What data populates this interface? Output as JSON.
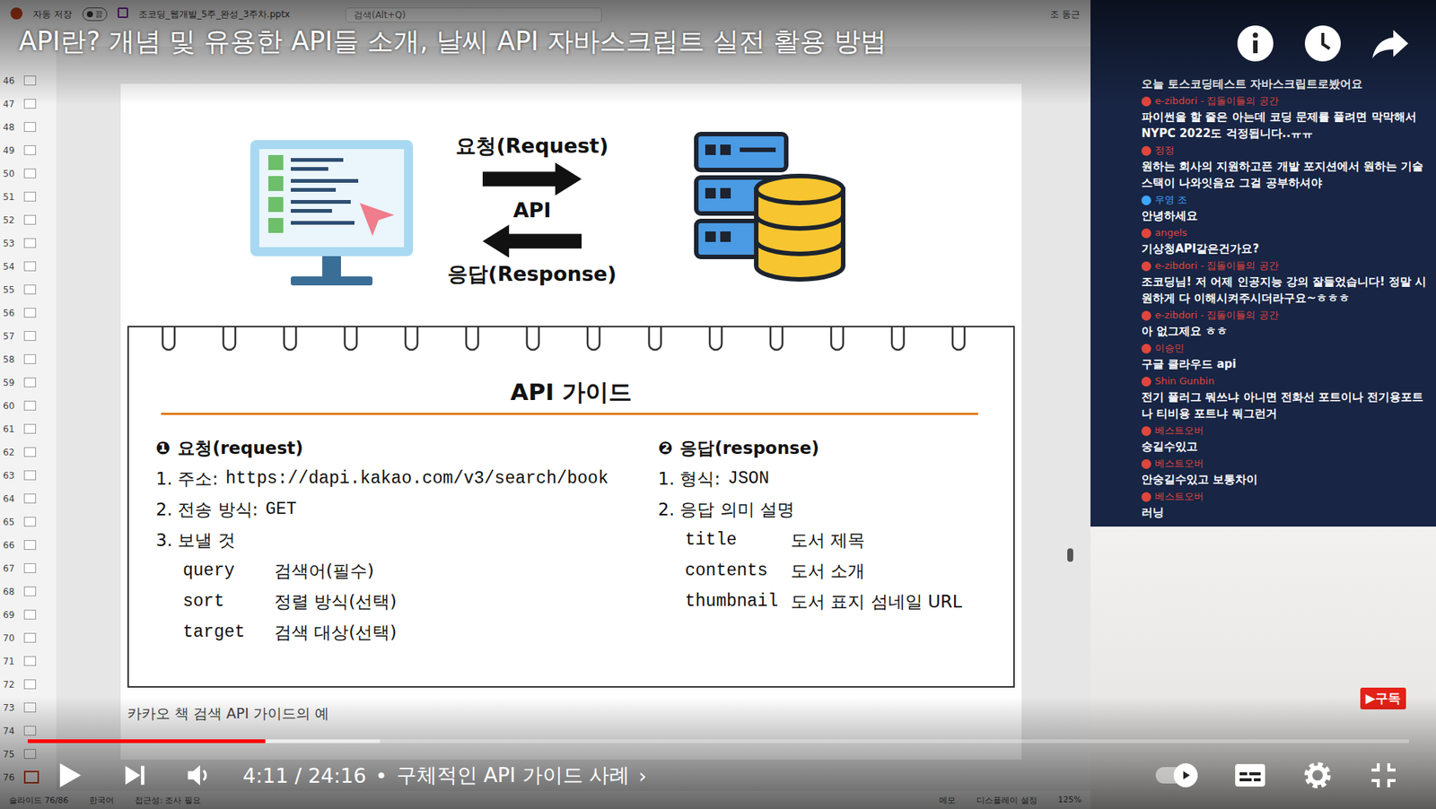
{
  "video": {
    "title": "API란? 개념 및 유용한 API들 소개, 날씨 API 자바스크립트 실전 활용 방법",
    "current_time": "4:11",
    "duration": "24:16",
    "separator": "•",
    "chapter": "구체적인 API 가이드 사례",
    "chapter_arrow": "›",
    "played": 0.172,
    "buffered": 0.255,
    "playing": false,
    "autoplay": true,
    "subtitles": false,
    "subscribe_badge": "▶구독"
  },
  "ppt": {
    "autosave_label": "자동 저장",
    "autosave_state": "끔",
    "autosave_on": false,
    "file_name": "조코딩_웹개발_5주_완성_3주차.pptx",
    "search_placeholder": "검색(Alt+Q)",
    "user": "조 동근",
    "thumbnails": [
      {
        "n": "46",
        "selected": false
      },
      {
        "n": "47",
        "selected": false
      },
      {
        "n": "48",
        "selected": false
      },
      {
        "n": "49",
        "selected": false
      },
      {
        "n": "50",
        "selected": false
      },
      {
        "n": "51",
        "selected": false
      },
      {
        "n": "52",
        "selected": false
      },
      {
        "n": "53",
        "selected": false
      },
      {
        "n": "54",
        "selected": false
      },
      {
        "n": "55",
        "selected": false
      },
      {
        "n": "56",
        "selected": false
      },
      {
        "n": "57",
        "selected": false
      },
      {
        "n": "58",
        "selected": false
      },
      {
        "n": "59",
        "selected": false
      },
      {
        "n": "60",
        "selected": false
      },
      {
        "n": "61",
        "selected": false
      },
      {
        "n": "62",
        "selected": false
      },
      {
        "n": "63",
        "selected": false
      },
      {
        "n": "64",
        "selected": false
      },
      {
        "n": "65",
        "selected": false
      },
      {
        "n": "66",
        "selected": false
      },
      {
        "n": "67",
        "selected": false
      },
      {
        "n": "68",
        "selected": false
      },
      {
        "n": "69",
        "selected": false
      },
      {
        "n": "70",
        "selected": false
      },
      {
        "n": "71",
        "selected": false
      },
      {
        "n": "72",
        "selected": false
      },
      {
        "n": "73",
        "selected": false
      },
      {
        "n": "74",
        "selected": false
      },
      {
        "n": "75",
        "selected": false
      },
      {
        "n": "76",
        "selected": true
      }
    ],
    "status_bar": {
      "left": [
        "슬라이드 76/86",
        "한국어",
        "접근성: 조사 필요"
      ],
      "right": [
        "메모",
        "디스플레이 설정",
        "125%"
      ]
    }
  },
  "slide": {
    "diagram": {
      "request": "요청(Request)",
      "api": "API",
      "response": "응답(Response)"
    },
    "guide_title": "API 가이드",
    "request": {
      "badge": "❶",
      "heading": "요청(request)",
      "items": [
        {
          "label": "1. 주소:",
          "value": "https://dapi.kakao.com/v3/search/book"
        },
        {
          "label": "2. 전송 방식:",
          "value": "GET"
        },
        {
          "label": "3. 보낼 것"
        }
      ],
      "params": [
        {
          "key": "query",
          "desc": "검색어(필수)"
        },
        {
          "key": "sort",
          "desc": "정렬 방식(선택)"
        },
        {
          "key": "target",
          "desc": "검색 대상(선택)"
        }
      ]
    },
    "response": {
      "badge": "❷",
      "heading": "응답(response)",
      "items": [
        {
          "label": "1. 형식:",
          "value": "JSON"
        },
        {
          "label": "2. 응답 의미 설명"
        }
      ],
      "params": [
        {
          "key": "title",
          "desc": "도서 제목"
        },
        {
          "key": "contents",
          "desc": "도서 소개"
        },
        {
          "key": "thumbnail",
          "desc": "도서 표지 섬네일 URL"
        }
      ]
    },
    "caption": "카카오 책 검색 API 가이드의 예"
  },
  "chat": [
    {
      "author": "",
      "text": "오늘 토스코딩테스트 자바스크립트로봤어요",
      "color": "#ffffff"
    },
    {
      "author": "e-zibdori - 집돌이들의 공간",
      "text": "파이썬을 할 줄은 아는데 코딩 문제를 풀려면 막막해서 NYPC 2022도 걱정됩니다..ㅠㅠ",
      "color": "#e0463c"
    },
    {
      "author": "정정",
      "text": "원하는 회사의 지원하고픈 개발 포지션에서 원하는 기술스택이 나와잇음요 그걸 공부하셔야",
      "color": "#e0463c"
    },
    {
      "author": "우영 조",
      "text": "안녕하세요",
      "color": "#3ea6ff"
    },
    {
      "author": "angels",
      "text": "기상청API같은건가요?",
      "color": "#e0463c"
    },
    {
      "author": "e-zibdori - 집돌이들의 공간",
      "text": "조코딩님! 저 어제 인공지능 강의 잘들었습니다! 정말 시원하게 다 이해시켜주시더라구요~ㅎㅎㅎ",
      "color": "#e0463c"
    },
    {
      "author": "e-zibdori - 집돌이들의 공간",
      "text": "아 없그제요 ㅎㅎ",
      "color": "#e0463c"
    },
    {
      "author": "이승민",
      "text": "구글 클라우드 api",
      "color": "#e0463c"
    },
    {
      "author": "Shin Gunbin",
      "text": "전기 플러그 뭐쓰냐 아니면 전화선 포트이나 전기용포트나 티비용 포트냐 뭐그런거",
      "color": "#e0463c"
    },
    {
      "author": "베스트오버",
      "text": "숭길수있고",
      "color": "#e0463c"
    },
    {
      "author": "베스트오버",
      "text": "안숭길수있고 보통차이",
      "color": "#e0463c"
    },
    {
      "author": "베스트오버",
      "text": "러닝",
      "color": "#e0463c"
    }
  ]
}
